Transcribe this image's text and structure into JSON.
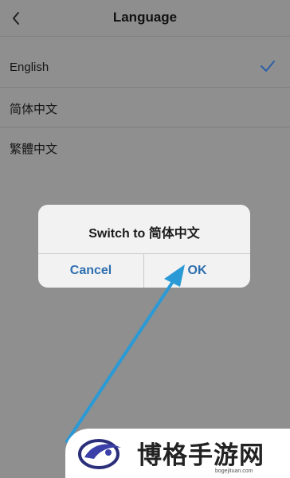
{
  "header": {
    "title": "Language",
    "back_icon": "chevron-left-icon"
  },
  "languages": [
    {
      "label": "English",
      "selected": true
    },
    {
      "label": "简体中文",
      "selected": false
    },
    {
      "label": "繁體中文",
      "selected": false
    }
  ],
  "dialog": {
    "message": "Switch to 简体中文",
    "cancel_label": "Cancel",
    "ok_label": "OK"
  },
  "watermark": {
    "text": "博格手游网",
    "url": "bogejituan.com"
  },
  "colors": {
    "accent": "#2e6fb0",
    "check": "#2b5fa8",
    "arrow": "#2a9ad6",
    "dim_background": "#8f8f8f"
  }
}
